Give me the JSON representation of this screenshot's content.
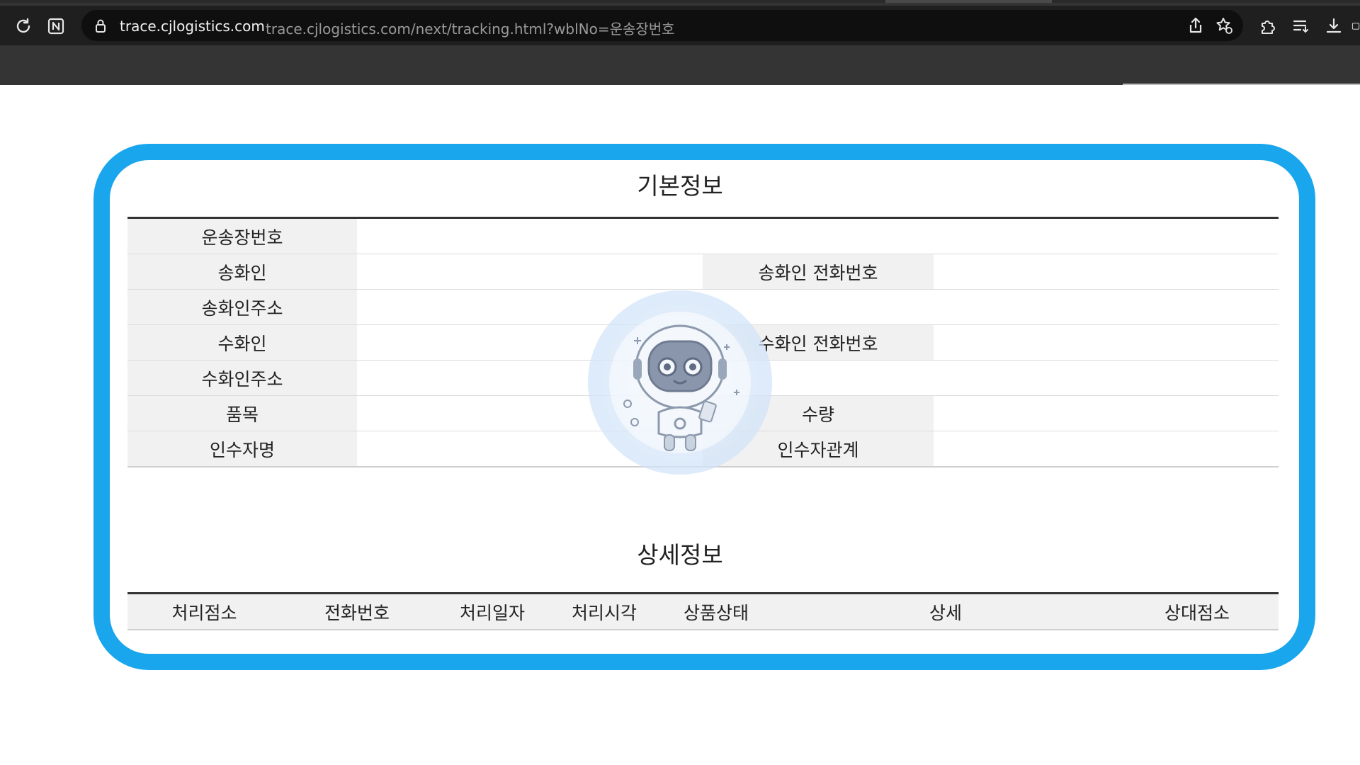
{
  "browser": {
    "host": "trace.cjlogistics.com",
    "url_path": "trace.cjlogistics.com/next/tracking.html?wblNo=운송장번호",
    "icons": [
      "reload-icon",
      "n-badge-icon",
      "lock-icon",
      "share-icon",
      "favorite-icon",
      "extensions-icon",
      "reading-list-icon",
      "download-icon"
    ]
  },
  "basic_info": {
    "title": "기본정보",
    "rows": [
      {
        "label": "운송장번호"
      },
      {
        "label": "송화인",
        "label2": "송화인 전화번호"
      },
      {
        "label": "송화인주소"
      },
      {
        "label": "수화인",
        "label2": "수화인 전화번호"
      },
      {
        "label": "수화인주소"
      },
      {
        "label": "품목",
        "label2": "수량"
      },
      {
        "label": "인수자명",
        "label2": "인수자관계"
      }
    ]
  },
  "detail_info": {
    "title": "상세정보",
    "headers": [
      "처리점소",
      "전화번호",
      "처리일자",
      "처리시각",
      "상품상태",
      "상세",
      "상대점소"
    ]
  },
  "colors": {
    "frame": "#1aa6ec",
    "header_bg": "#f1f1f1",
    "browser_bg": "#343434"
  }
}
